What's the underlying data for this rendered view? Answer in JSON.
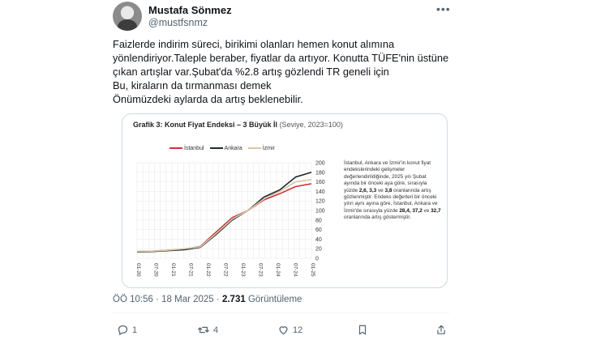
{
  "author": {
    "name": "Mustafa Sönmez",
    "handle": "@mustfsnmz"
  },
  "more_icon": "more-dots-icon",
  "tweet_lines": [
    "Faizlerde indirim süreci,  birikimi olanları hemen konut alımına",
    "yönlendiriyor.Taleple beraber, fiyatlar da artıyor. Konutta TÜFE'nin üstüne",
    "çıkan artışlar var.Şubat'da %2.8 artış gözlendi TR geneli için",
    "Bu, kiraların da tırmanması demek",
    "Önümüzdeki aylarda da artış beklenebilir."
  ],
  "media": {
    "title_bold": "Grafik 3: Konut Fiyat Endeksi – 3 Büyük İl",
    "title_sub": "(Seviye, 2023=100)",
    "note_html_parts": [
      "İstanbul, Ankara ve İzmir'in konut fiyat endekslerindeki gelişmeler değerlendirildiğinde, 2025 yılı Şubat ayında bir önceki aya göre, sırasıyla yüzde ",
      "2,6, 3,3",
      " ve ",
      "3,8",
      " oranlarında artış gözlenmiştir. Endeks değerleri bir önceki yılın aynı ayına göre, İstanbul, Ankara ve İzmir'de sırasıyla yüzde ",
      "28,4, 37,2",
      " ve ",
      "32,7",
      " oranlarında artış göstermiştir."
    ]
  },
  "chart_data": {
    "type": "line",
    "title": "Grafik 3: Konut Fiyat Endeksi – 3 Büyük İl",
    "subtitle": "(Seviye, 2023=100)",
    "x_tick_labels": [
      "01-20",
      "07-20",
      "01-21",
      "07-21",
      "01-22",
      "07-22",
      "01-23",
      "07-23",
      "01-24",
      "07-24",
      "01-25"
    ],
    "y_ticks": [
      0,
      20,
      40,
      60,
      80,
      100,
      120,
      140,
      160,
      180,
      200
    ],
    "ylim": [
      0,
      200
    ],
    "grid": true,
    "legend_position": "top-left",
    "x": [
      "01-20",
      "07-20",
      "01-21",
      "07-21",
      "01-22",
      "07-22",
      "01-23",
      "07-23",
      "01-24",
      "07-24",
      "01-25",
      "02-25"
    ],
    "series": [
      {
        "name": "İstanbul",
        "color": "#c8323c",
        "values": [
          14,
          15,
          17,
          19,
          25,
          55,
          85,
          100,
          122,
          135,
          150,
          156
        ]
      },
      {
        "name": "Ankara",
        "color": "#1f2a36",
        "values": [
          13,
          14,
          16,
          18,
          23,
          50,
          80,
          100,
          128,
          143,
          170,
          180
        ]
      },
      {
        "name": "İzmir",
        "color": "#d9c7a4",
        "values": [
          14,
          15,
          17,
          20,
          24,
          52,
          82,
          100,
          124,
          140,
          160,
          165
        ]
      }
    ]
  },
  "meta": {
    "time": "ÖÖ 10:56",
    "dot": "·",
    "date": "18 Mar 2025",
    "views": "2.731",
    "views_label": "Görüntüleme"
  },
  "actions": {
    "reply_count": "1",
    "retweet_count": "4",
    "like_count": "12"
  }
}
